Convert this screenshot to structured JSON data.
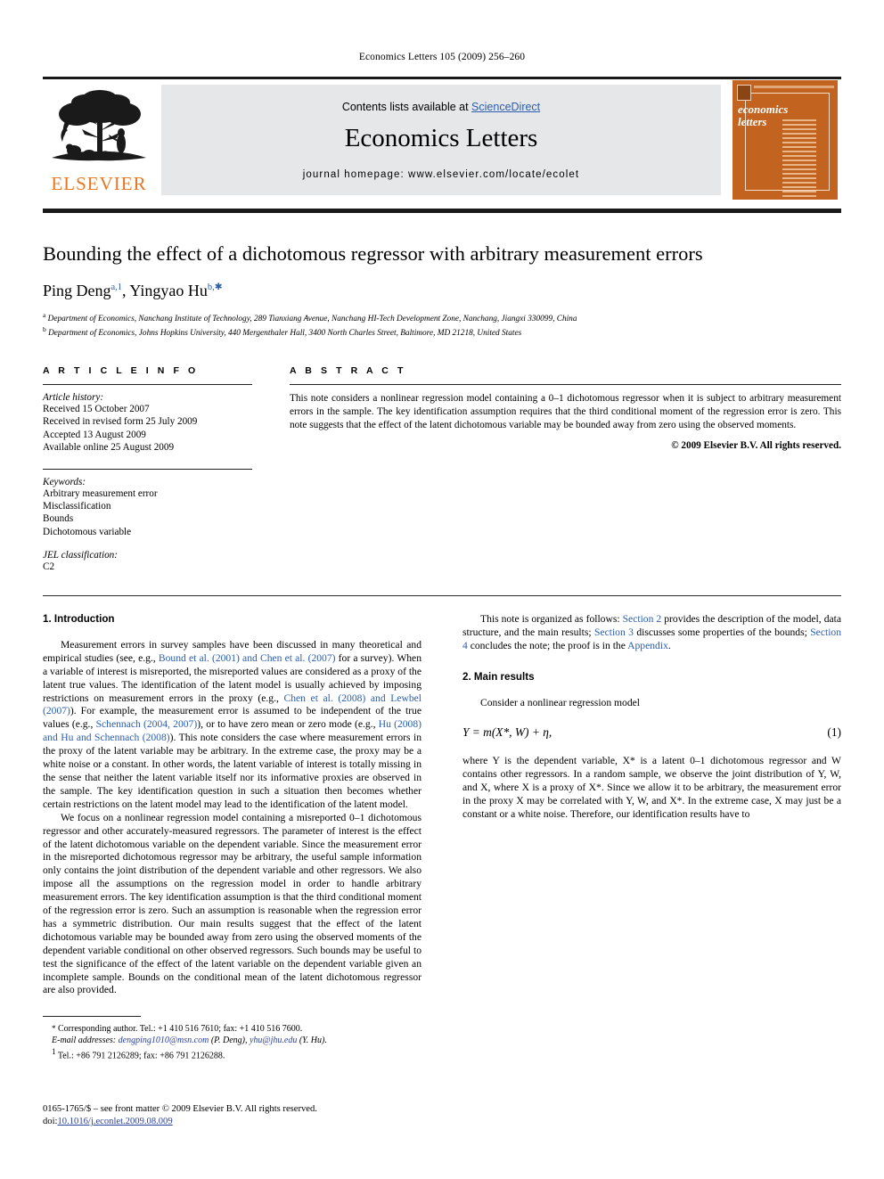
{
  "running_head": "Economics Letters 105 (2009) 256–260",
  "masthead": {
    "publisher": "ELSEVIER",
    "contents_prefix": "Contents lists available at ",
    "contents_link": "ScienceDirect",
    "journal_name": "Economics Letters",
    "homepage": "journal homepage: www.elsevier.com/locate/ecolet",
    "cover": {
      "line1": "economics",
      "line2": "letters"
    },
    "colors": {
      "band": "#e6e7e9",
      "link": "#2a5db0",
      "elsevier_orange": "#E87722",
      "cover_orange": "#c2641f"
    }
  },
  "title": "Bounding the effect of a dichotomous regressor with arbitrary measurement errors",
  "authors": {
    "author1_name": "Ping Deng",
    "author1_marks": "a,1",
    "separator": ", ",
    "author2_name": "Yingyao Hu",
    "author2_marks": "b,"
  },
  "affiliations": [
    {
      "marker": "a",
      "text": "Department of Economics, Nanchang Institute of Technology, 289 Tianxiang Avenue, Nanchang HI-Tech Development Zone, Nanchang, Jiangxi 330099, China"
    },
    {
      "marker": "b",
      "text": "Department of Economics, Johns Hopkins University, 440 Mergenthaler Hall, 3400 North Charles Street, Baltimore, MD 21218, United States"
    }
  ],
  "article_info": {
    "heading": "A R T I C L E    I N F O",
    "history_label": "Article history:",
    "history": [
      "Received 15 October 2007",
      "Received in revised form 25 July 2009",
      "Accepted 13 August 2009",
      "Available online 25 August 2009"
    ],
    "keywords_label": "Keywords:",
    "keywords": [
      "Arbitrary measurement error",
      "Misclassification",
      "Bounds",
      "Dichotomous variable"
    ],
    "jel_label": "JEL classification:",
    "jel_codes": "C2"
  },
  "abstract": {
    "heading": "A B S T R A C T",
    "text": "This note considers a nonlinear regression model containing a 0–1 dichotomous regressor when it is subject to arbitrary measurement errors in the sample. The key identification assumption requires that the third conditional moment of the regression error is zero. This note suggests that the effect of the latent dichotomous variable may be bounded away from zero using the observed moments.",
    "rights": "© 2009 Elsevier B.V. All rights reserved."
  },
  "sections": {
    "intro_heading": "1. Introduction",
    "main_results_heading": "2. Main results"
  },
  "body": {
    "p1_a": "Measurement errors in survey samples have been discussed in many theoretical and empirical studies (see, e.g., ",
    "p1_ref1": "Bound et al. (2001) and Chen et al. (2007)",
    "p1_b": " for a survey). When a variable of interest is misreported, the misreported values are considered as a proxy of the latent true values. The identification of the latent model is usually achieved by imposing restrictions on measurement errors in the proxy (e.g., ",
    "p1_ref2": "Chen et al. (2008) and Lewbel (2007)",
    "p1_c": "). For example, the measurement error is assumed to be independent of the true values (e.g., ",
    "p1_ref3": "Schennach (2004, 2007)",
    "p1_d": "), or to have zero mean or zero mode (e.g., ",
    "p1_ref4": "Hu (2008) and Hu and Schennach (2008)",
    "p1_e": "). This note considers the case where measurement errors in the proxy of the latent variable may be arbitrary. In the extreme case, the proxy may be a white noise or a constant. In other words, the latent variable of interest is totally missing in the sense that neither the latent variable itself nor its informative proxies are observed in the sample. The key identification question in such a situation then becomes whether certain restrictions on the latent model may lead to the identification of the latent model.",
    "p2": "We focus on a nonlinear regression model containing a misreported 0–1 dichotomous regressor and other accurately-measured regressors. The parameter of interest is the effect of the latent dichotomous variable on the dependent variable. Since the measurement error in the misreported dichotomous regressor may be arbitrary, the useful sample information only contains the joint distribution of the dependent variable and other regressors. We also impose all the assumptions on the regression model in order to handle arbitrary measurement errors. The key identification assumption is that the third conditional moment of the regression error is zero. Such an assumption is reasonable when the regression error has a symmetric distribution. Our main results suggest that the effect of the latent dichotomous variable may be bounded away from zero using the observed moments of the dependent variable conditional on other observed regressors. Such bounds may be useful to test the significance of the effect of the latent variable on the dependent variable given an incomplete sample. Bounds on the conditional mean of the latent dichotomous regressor are also provided.",
    "p3_a": "This note is organized as follows: ",
    "p3_ref1": "Section 2",
    "p3_b": " provides the description of the model, data structure, and the main results; ",
    "p3_ref2": "Section 3",
    "p3_c": " discusses some properties of the bounds; ",
    "p3_ref3": "Section 4",
    "p3_d": " concludes the note; the proof is in the ",
    "p3_ref4": "Appendix",
    "p3_e": ".",
    "p4": "Consider a nonlinear regression model",
    "equation": "Y = m(X*, W) + η,",
    "equation_number": "(1)",
    "p5": "where Y is the dependent variable, X* is a latent 0–1 dichotomous regressor and W contains other regressors. In a random sample, we observe the joint distribution of Y, W, and X, where X is a proxy of X*. Since we allow it to be arbitrary, the measurement error in the proxy X may be correlated with Y, W, and X*. In the extreme case, X may just be a constant or a white noise. Therefore, our identification results have to"
  },
  "footnotes": {
    "corresponding": "Corresponding author. Tel.: +1 410 516 7610; fax: +1 410 516 7600.",
    "corresponding_marker": "*",
    "email_label": "E-mail addresses:",
    "email1": "dengping1010@msn.com",
    "email1_owner": " (P. Deng), ",
    "email2": "yhu@jhu.edu",
    "email2_owner": " (Y. Hu).",
    "tel_marker": "1",
    "tel": "Tel.: +86 791 2126289; fax: +86 791 2126288."
  },
  "imprint": {
    "line1": "0165-1765/$ – see front matter © 2009 Elsevier B.V. All rights reserved.",
    "doi_label": "doi:",
    "doi": "10.1016/j.econlet.2009.08.009"
  }
}
